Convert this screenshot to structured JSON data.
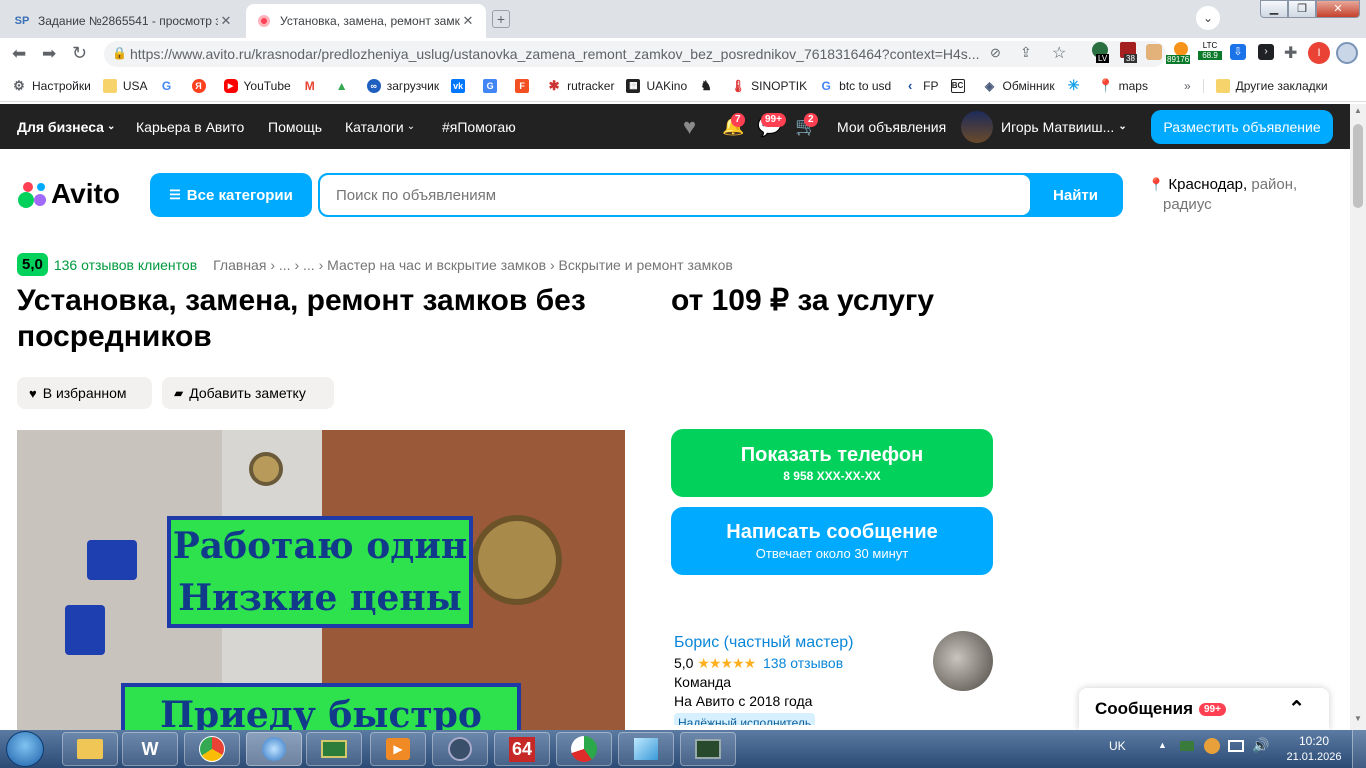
{
  "browser": {
    "tabs": [
      {
        "favicon": "SP",
        "title": "Задание №2865541 - просмотр з",
        "active": false
      },
      {
        "favicon": "avito-icon",
        "title": "Установка, замена, ремонт замко",
        "active": true
      }
    ],
    "url": "https://www.avito.ru/krasnodar/predlozheniya_uslug/ustanovka_zamena_remont_zamkov_bez_posrednikov_7618316464?context=H4s...",
    "extensions": {
      "ext1_badge": "LV",
      "ext2_badge": "38",
      "ext3_badge": "89176",
      "ltc_label": "LTC",
      "ltc_value": "68.9"
    },
    "bookmarks": [
      {
        "label": "Настройки",
        "icon": "gear-icon"
      },
      {
        "label": "USA",
        "icon": "folder-icon"
      },
      {
        "label": "",
        "icon": "google-icon"
      },
      {
        "label": "",
        "icon": "yandex-icon"
      },
      {
        "label": "YouTube",
        "icon": "youtube-icon"
      },
      {
        "label": "",
        "icon": "gmail-icon"
      },
      {
        "label": "",
        "icon": "drive-icon"
      },
      {
        "label": "загрузчик",
        "icon": "loader-icon"
      },
      {
        "label": "",
        "icon": "vk-icon"
      },
      {
        "label": "",
        "icon": "translate-icon"
      },
      {
        "label": "",
        "icon": "f-icon"
      },
      {
        "label": "rutracker",
        "icon": "rutracker-icon"
      },
      {
        "label": "UAKino",
        "icon": "uakino-icon"
      },
      {
        "label": "",
        "icon": "chess-icon"
      },
      {
        "label": "SINOPTIK",
        "icon": "thermometer-icon"
      },
      {
        "label": "btc to usd",
        "icon": "google-icon"
      },
      {
        "label": "FP",
        "icon": "fp-icon"
      },
      {
        "label": "",
        "icon": "bc-icon"
      },
      {
        "label": "Обмінник",
        "icon": "exchange-icon"
      },
      {
        "label": "",
        "icon": "snowflake-icon"
      },
      {
        "label": "maps",
        "icon": "maps-icon"
      }
    ],
    "bookmarks_more": "»",
    "other_bookmarks": "Другие закладки"
  },
  "topbar": {
    "business": "Для бизнеса",
    "career": "Карьера в Авито",
    "help": "Помощь",
    "catalogs": "Каталоги",
    "hashtag": "#яПомогаю",
    "notif_badge": "7",
    "chat_badge": "99+",
    "cart_badge": "2",
    "my_ads": "Мои объявления",
    "user": "Игорь Матвииш...",
    "post_ad": "Разместить объявление"
  },
  "search": {
    "logo": "Avito",
    "all_categories": "Все категории",
    "placeholder": "Поиск по объявлениям",
    "find": "Найти",
    "location_city": "Краснодар,",
    "location_rest": "район,",
    "location_rest2": "радиус"
  },
  "listing": {
    "rating": "5,0",
    "reviews_link": "136 отзывов клиентов",
    "breadcrumbs": [
      "Главная",
      "...",
      "...",
      "Мастер на час и вскрытие замков",
      "Вскрытие и ремонт замков"
    ],
    "title": "Установка, замена, ремонт замков без посредников",
    "price": "от 109 ₽ за услугу",
    "favorite": "В избранном",
    "add_note": "Добавить заметку",
    "photo_text1": "Работаю один",
    "photo_text2": "Низкие цены",
    "photo_text3": "Приеду быстро"
  },
  "contact": {
    "show_phone": "Показать телефон",
    "phone": "8 958 XXX-XX-XX",
    "write_message": "Написать сообщение",
    "response_time": "Отвечает около 30 минут"
  },
  "seller": {
    "name": "Борис (частный мастер)",
    "rating": "5,0",
    "stars": 5,
    "reviews": "138 отзывов",
    "type": "Команда",
    "since": "На Авито с 2018 года",
    "badge": "Надёжный исполнитель"
  },
  "messages_panel": {
    "title": "Сообщения",
    "badge": "99+"
  },
  "taskbar": {
    "lang": "UK",
    "time": "10:20",
    "date": "21.01.2026",
    "app_64": "64"
  },
  "colors": {
    "avito_blue": "#00aaff",
    "avito_green": "#02d15c",
    "badge_red": "#ff4053",
    "topbar": "#222222"
  }
}
